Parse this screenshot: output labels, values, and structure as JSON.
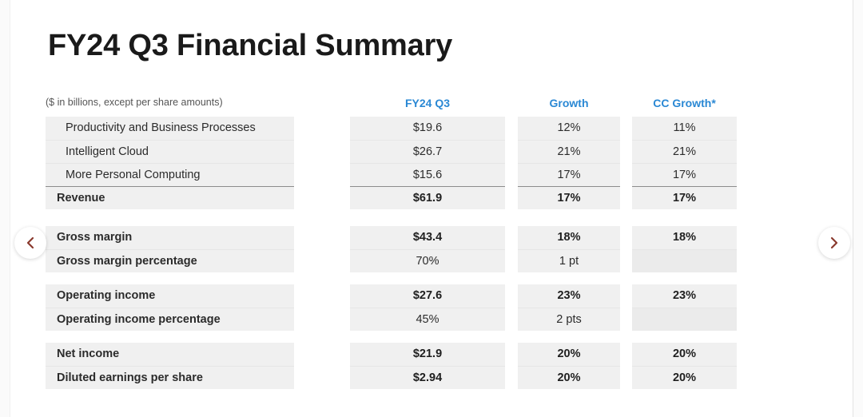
{
  "page": {
    "title": "FY24 Q3 Financial Summary",
    "caption": "($ in billions, except per share amounts)",
    "accent_blue": "#2a88d4",
    "cell_background": "#f0f0f0",
    "arrow_color": "#8a3a2e"
  },
  "columns": {
    "label": "",
    "c1": "FY24 Q3",
    "c2": "Growth",
    "c3": "CC Growth*"
  },
  "blocks": [
    {
      "name": "revenue-block",
      "rows": [
        {
          "label": "Productivity and Business Processes",
          "c1": "$19.6",
          "c2": "12%",
          "c3": "11%",
          "bold": false,
          "indent": true,
          "total": false
        },
        {
          "label": "Intelligent Cloud",
          "c1": "$26.7",
          "c2": "21%",
          "c3": "21%",
          "bold": false,
          "indent": true,
          "total": false
        },
        {
          "label": "More Personal Computing",
          "c1": "$15.6",
          "c2": "17%",
          "c3": "17%",
          "bold": false,
          "indent": true,
          "total": false
        },
        {
          "label": "Revenue",
          "c1": "$61.9",
          "c2": "17%",
          "c3": "17%",
          "bold": true,
          "indent": false,
          "total": true
        }
      ]
    },
    {
      "name": "gross-margin-block",
      "rows": [
        {
          "label": "Gross margin",
          "c1": "$43.4",
          "c2": "18%",
          "c3": "18%",
          "bold": true,
          "indent": false,
          "total": false
        },
        {
          "label": "Gross margin percentage",
          "c1": "70%",
          "c2": "1 pt",
          "c3": "",
          "bold": false,
          "indent": false,
          "total": false
        }
      ]
    },
    {
      "name": "operating-income-block",
      "rows": [
        {
          "label": "Operating income",
          "c1": "$27.6",
          "c2": "23%",
          "c3": "23%",
          "bold": true,
          "indent": false,
          "total": false
        },
        {
          "label": "Operating income percentage",
          "c1": "45%",
          "c2": "2 pts",
          "c3": "",
          "bold": false,
          "indent": false,
          "total": false
        }
      ]
    },
    {
      "name": "net-income-block",
      "rows": [
        {
          "label": "Net income",
          "c1": "$21.9",
          "c2": "20%",
          "c3": "20%",
          "bold": true,
          "indent": false,
          "total": false
        },
        {
          "label": "Diluted earnings per share",
          "c1": "$2.94",
          "c2": "20%",
          "c3": "20%",
          "bold": true,
          "indent": false,
          "total": false
        }
      ]
    }
  ],
  "carousel": {
    "prev_icon": "chevron-left-icon",
    "next_icon": "chevron-right-icon"
  }
}
